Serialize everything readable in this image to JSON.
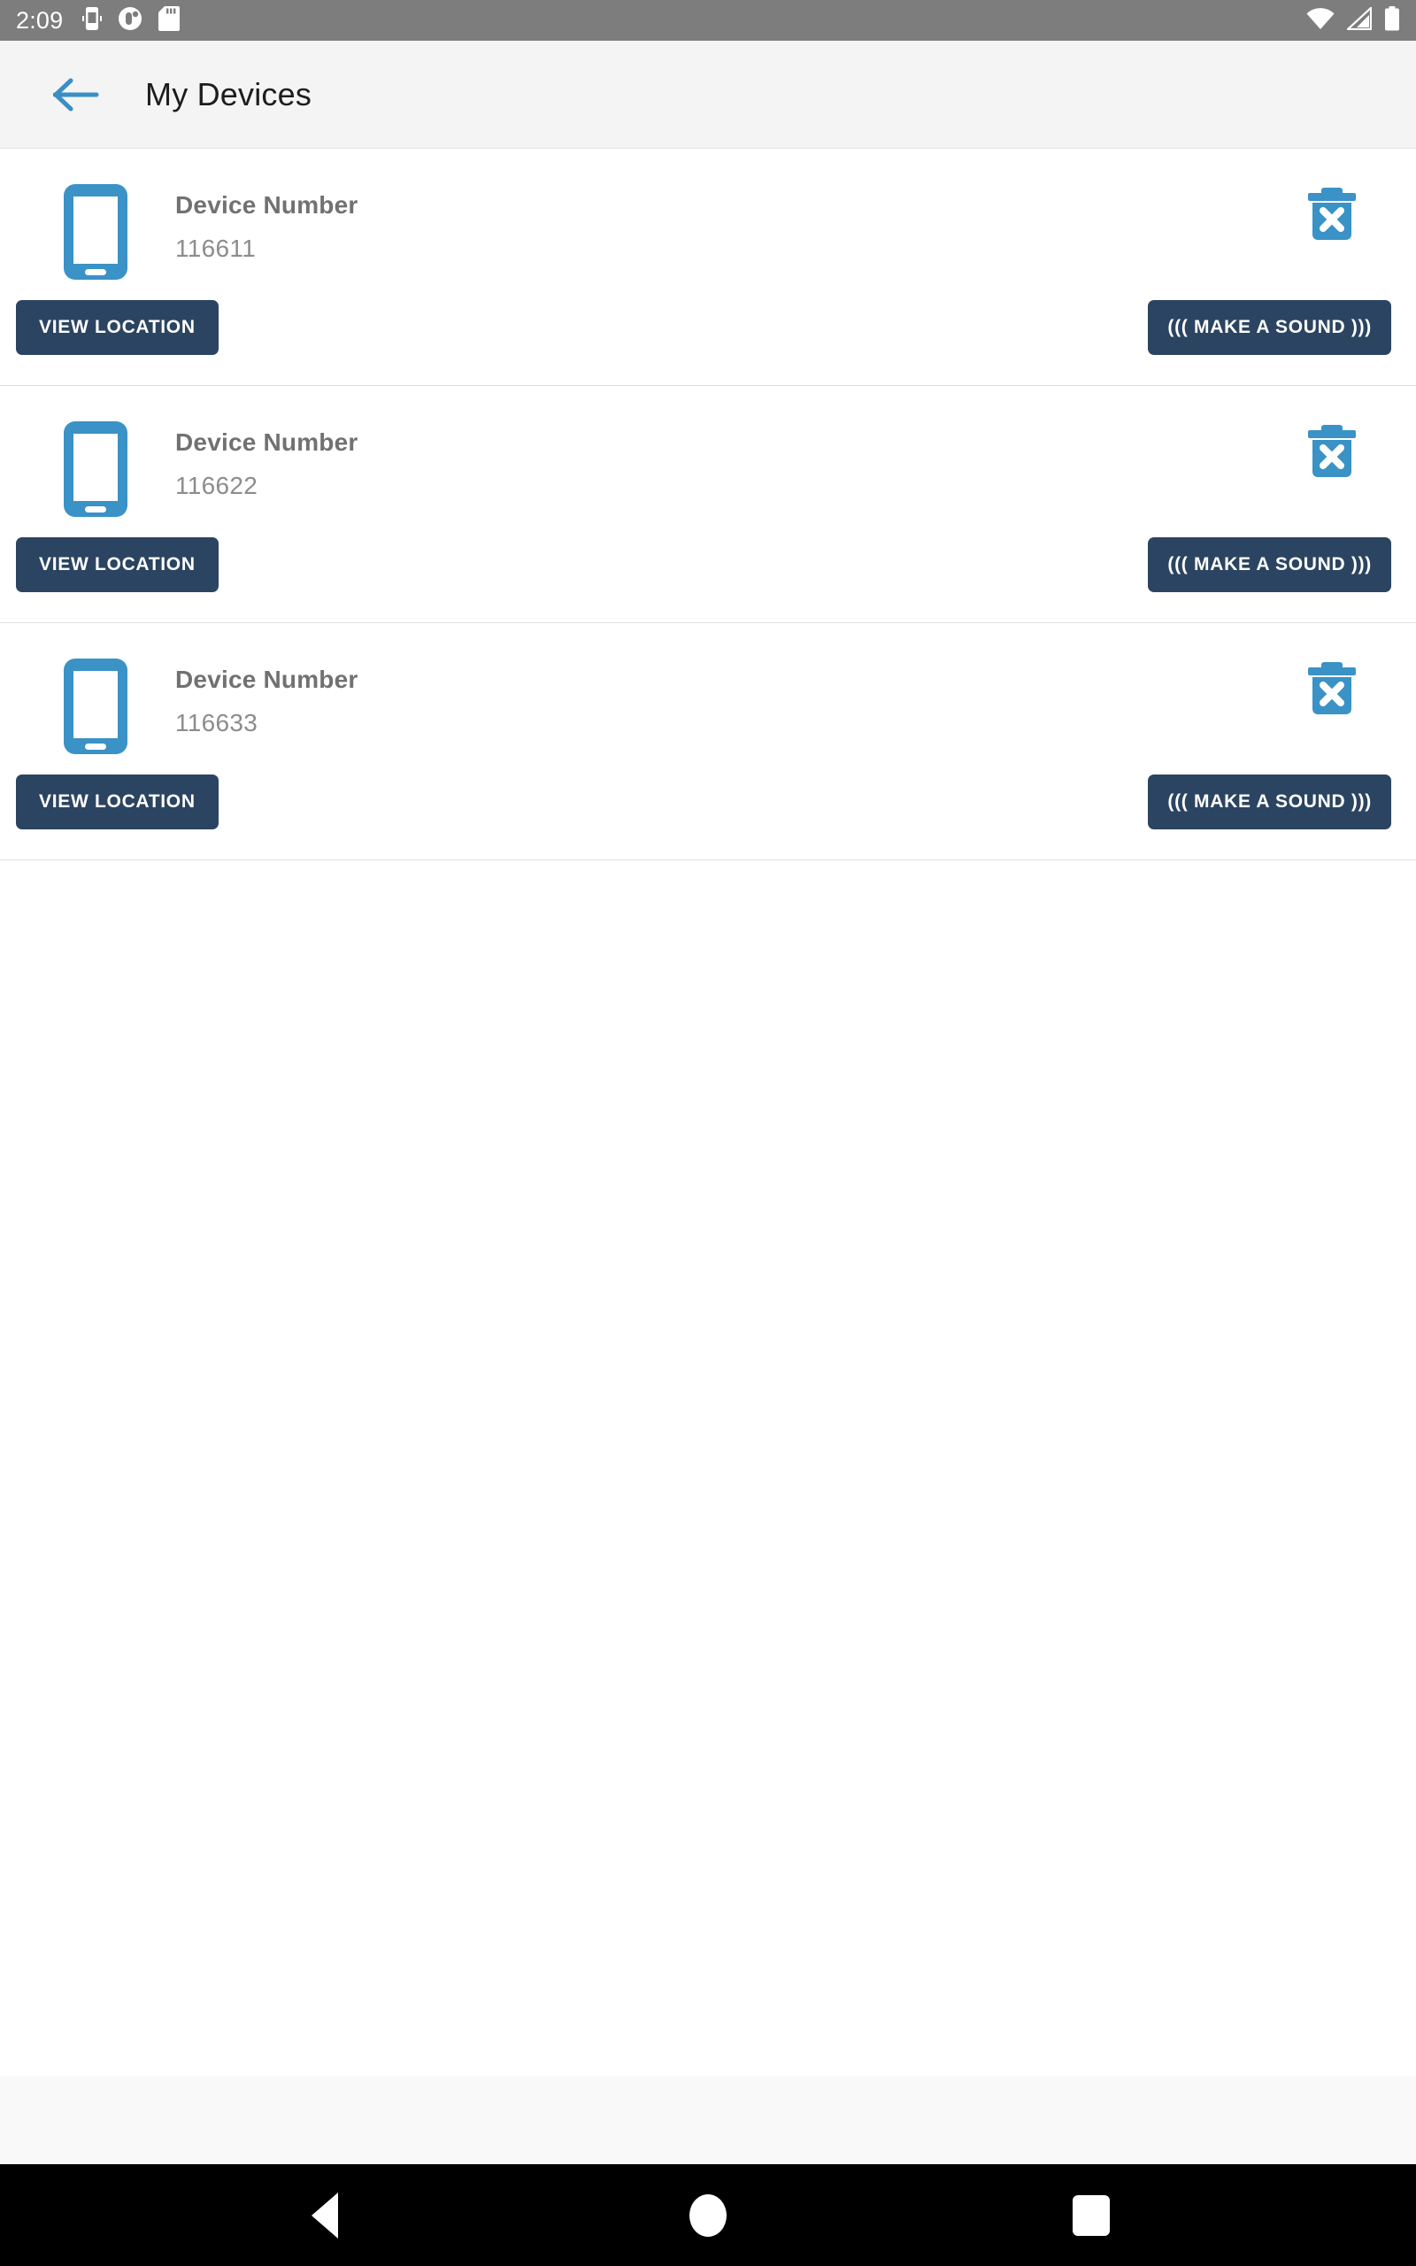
{
  "status_bar": {
    "clock": "2:09",
    "left_icons": [
      "vibrate-icon",
      "do-not-disturb-icon",
      "sd-card-icon"
    ],
    "right_icons": [
      "wifi-icon",
      "cellular-signal-icon",
      "battery-icon"
    ],
    "background": "#7d7d7d"
  },
  "app_bar": {
    "back_icon": "back-arrow-icon",
    "title": "My Devices",
    "background": "#f4f4f4",
    "accent": "#3a8fc4"
  },
  "theme": {
    "device_icon_blue": "#3a92c6",
    "trash_icon_blue": "#3a92c6",
    "button_navy": "#2b4461",
    "label_gray": "#717171",
    "value_gray": "#8c8c8c"
  },
  "devices": [
    {
      "icon": "smartphone-icon",
      "label": "Device Number",
      "number": "116611",
      "delete_icon": "delete-trash-icon",
      "view_location_label": "VIEW LOCATION",
      "make_sound_label": "((( MAKE A SOUND )))"
    },
    {
      "icon": "smartphone-icon",
      "label": "Device Number",
      "number": "116622",
      "delete_icon": "delete-trash-icon",
      "view_location_label": "VIEW LOCATION",
      "make_sound_label": "((( MAKE A SOUND )))"
    },
    {
      "icon": "smartphone-icon",
      "label": "Device Number",
      "number": "116633",
      "delete_icon": "delete-trash-icon",
      "view_location_label": "VIEW LOCATION",
      "make_sound_label": "((( MAKE A SOUND )))"
    }
  ],
  "nav_bar": {
    "back_icon": "nav-back-icon",
    "home_icon": "nav-home-icon",
    "recents_icon": "nav-recents-icon",
    "background": "#000000"
  }
}
